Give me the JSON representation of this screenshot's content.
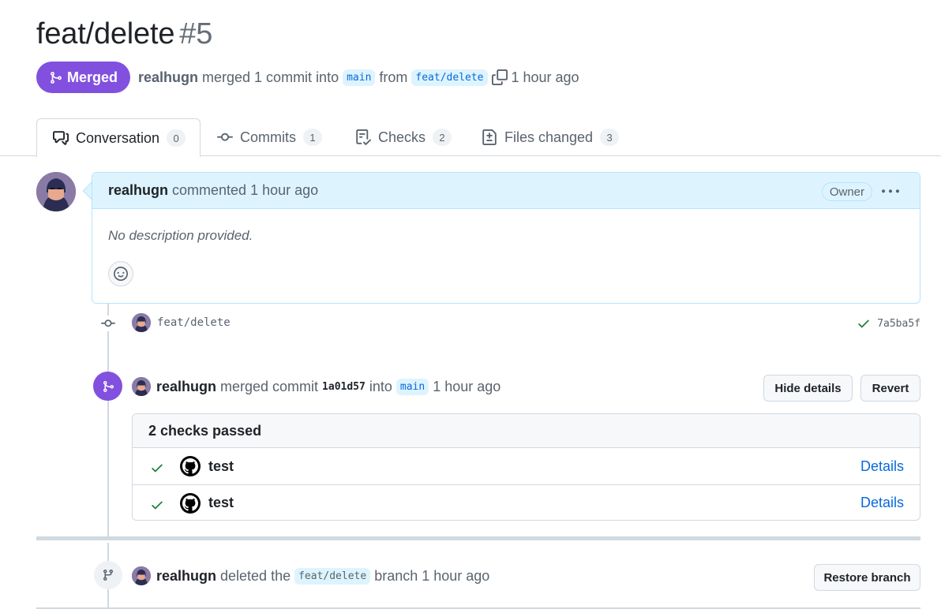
{
  "pr": {
    "title": "feat/delete",
    "number": "#5",
    "state_label": "Merged",
    "author": "realhugn",
    "meta_merged_text": "merged 1 commit into",
    "base_branch": "main",
    "from_text": "from",
    "head_branch": "feat/delete",
    "time": "1 hour ago"
  },
  "tabs": [
    {
      "label": "Conversation",
      "count": "0",
      "icon": "comment-discussion-icon"
    },
    {
      "label": "Commits",
      "count": "1",
      "icon": "commit-icon"
    },
    {
      "label": "Checks",
      "count": "2",
      "icon": "checklist-icon"
    },
    {
      "label": "Files changed",
      "count": "3",
      "icon": "file-diff-icon"
    }
  ],
  "comment": {
    "author": "realhugn",
    "action": "commented",
    "time": "1 hour ago",
    "role_badge": "Owner",
    "body": "No description provided."
  },
  "commit": {
    "message": "feat/delete",
    "sha": "7a5ba5f",
    "status": "success"
  },
  "merge_event": {
    "author": "realhugn",
    "action": "merged commit",
    "sha": "1a01d57",
    "into_text": "into",
    "branch": "main",
    "time": "1 hour ago",
    "hide_details_label": "Hide details",
    "revert_label": "Revert"
  },
  "checks": {
    "summary": "2 checks passed",
    "items": [
      {
        "name": "test",
        "link": "Details"
      },
      {
        "name": "test",
        "link": "Details"
      }
    ]
  },
  "branch_event": {
    "author": "realhugn",
    "action": "deleted the",
    "branch": "feat/delete",
    "suffix": "branch",
    "time": "1 hour ago",
    "restore_label": "Restore branch"
  },
  "colors": {
    "merged_purple": "#8250df",
    "link_blue": "#0969da",
    "branch_bg": "#ddf4ff",
    "success_green": "#1a7f37"
  }
}
